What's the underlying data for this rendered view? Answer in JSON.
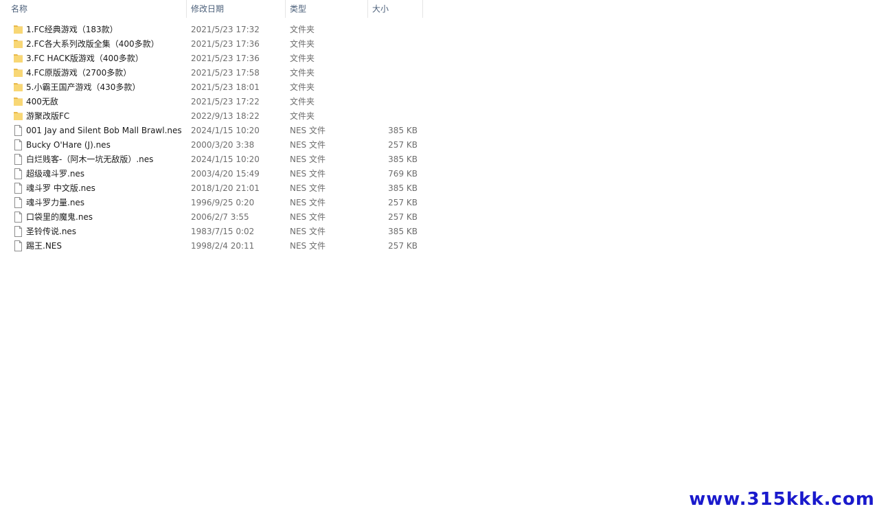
{
  "columns": {
    "name": "名称",
    "date": "修改日期",
    "type": "类型",
    "size": "大小"
  },
  "sort_indicator": "^",
  "files": [
    {
      "kind": "folder",
      "name": "1.FC经典游戏（183款）",
      "date": "2021/5/23 17:32",
      "type": "文件夹",
      "size": ""
    },
    {
      "kind": "folder",
      "name": "2.FC各大系列改版全集（400多款）",
      "date": "2021/5/23 17:36",
      "type": "文件夹",
      "size": ""
    },
    {
      "kind": "folder",
      "name": "3.FC HACK版游戏（400多款）",
      "date": "2021/5/23 17:36",
      "type": "文件夹",
      "size": ""
    },
    {
      "kind": "folder",
      "name": "4.FC原版游戏（2700多款）",
      "date": "2021/5/23 17:58",
      "type": "文件夹",
      "size": ""
    },
    {
      "kind": "folder",
      "name": "5.小霸王国产游戏（430多款）",
      "date": "2021/5/23 18:01",
      "type": "文件夹",
      "size": ""
    },
    {
      "kind": "folder",
      "name": "400无敌",
      "date": "2021/5/23 17:22",
      "type": "文件夹",
      "size": ""
    },
    {
      "kind": "folder",
      "name": "游聚改版FC",
      "date": "2022/9/13 18:22",
      "type": "文件夹",
      "size": ""
    },
    {
      "kind": "file",
      "name": "001 Jay and Silent Bob Mall Brawl.nes",
      "date": "2024/1/15 10:20",
      "type": "NES 文件",
      "size": "385 KB"
    },
    {
      "kind": "file",
      "name": "Bucky O'Hare (J).nes",
      "date": "2000/3/20 3:38",
      "type": "NES 文件",
      "size": "257 KB"
    },
    {
      "kind": "file",
      "name": "白烂贱客-（阿木一坑无敌版）.nes",
      "date": "2024/1/15 10:20",
      "type": "NES 文件",
      "size": "385 KB"
    },
    {
      "kind": "file",
      "name": "超级魂斗罗.nes",
      "date": "2003/4/20 15:49",
      "type": "NES 文件",
      "size": "769 KB"
    },
    {
      "kind": "file",
      "name": "魂斗罗 中文版.nes",
      "date": "2018/1/20 21:01",
      "type": "NES 文件",
      "size": "385 KB"
    },
    {
      "kind": "file",
      "name": "魂斗罗力量.nes",
      "date": "1996/9/25 0:20",
      "type": "NES 文件",
      "size": "257 KB"
    },
    {
      "kind": "file",
      "name": "口袋里的魔鬼.nes",
      "date": "2006/2/7 3:55",
      "type": "NES 文件",
      "size": "257 KB"
    },
    {
      "kind": "file",
      "name": "圣铃传说.nes",
      "date": "1983/7/15 0:02",
      "type": "NES 文件",
      "size": "385 KB"
    },
    {
      "kind": "file",
      "name": "踢王.NES",
      "date": "1998/2/4 20:11",
      "type": "NES 文件",
      "size": "257 KB"
    }
  ],
  "watermark": "www.315kkk.com",
  "colors": {
    "header_text": "#4c607a",
    "folder": "#f8d775",
    "folder_dark": "#e8b84a",
    "muted_text": "#6d6d6d",
    "watermark": "#1a1acc"
  },
  "icons": {
    "folder": "folder-icon",
    "file": "file-icon"
  }
}
